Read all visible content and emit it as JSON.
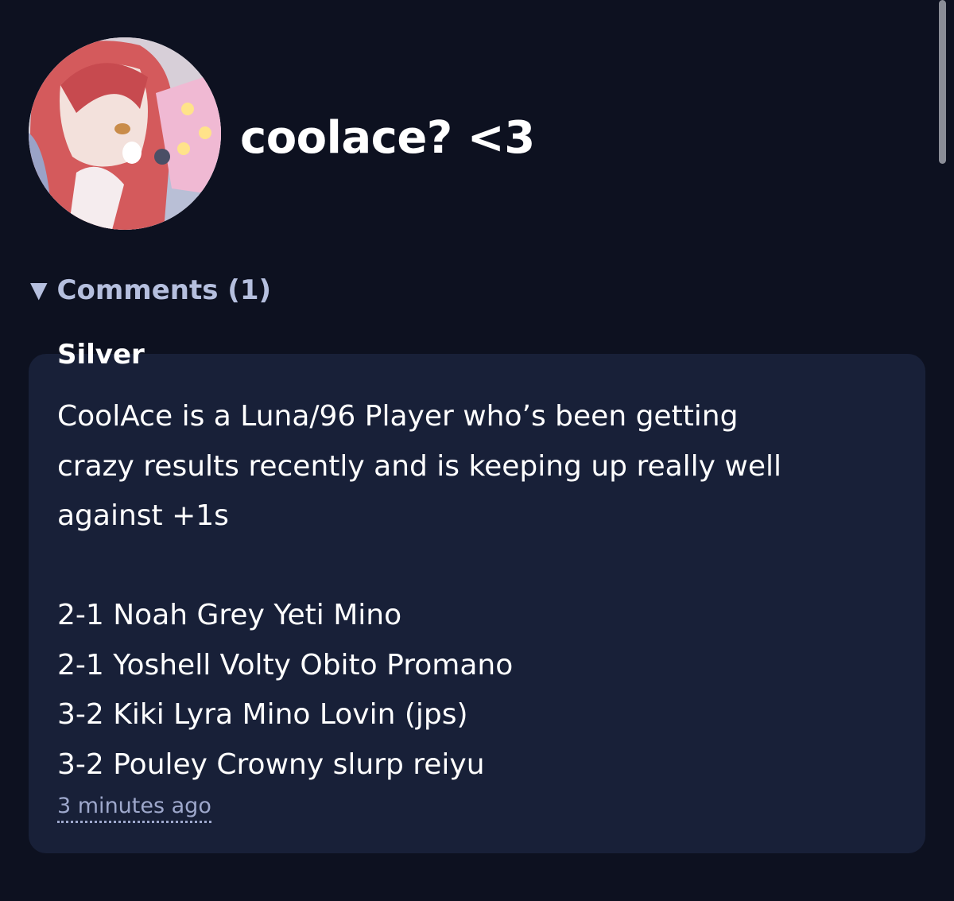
{
  "profile": {
    "title": "coolace? <3",
    "avatar_icon": "profile-avatar"
  },
  "comments": {
    "toggle_icon": "triangle-down-icon",
    "label": "Comments (1)",
    "items": [
      {
        "author": "Silver",
        "lines": [
          "CoolAce is a Luna/96 Player who’s been getting",
          "crazy results recently and is keeping up really well",
          "against +1s",
          "",
          "2-1 Noah Grey Yeti Mino",
          "2-1 Yoshell Volty Obito Promano",
          "3-2 Kiki Lyra Mino Lovin (jps)",
          "3-2 Pouley Crowny slurp reiyu"
        ],
        "timestamp": "3 minutes ago"
      }
    ]
  },
  "colors": {
    "background": "#0d1120",
    "card": "#182038",
    "accent_text": "#b5bfde",
    "muted_text": "#9ea8cc"
  }
}
